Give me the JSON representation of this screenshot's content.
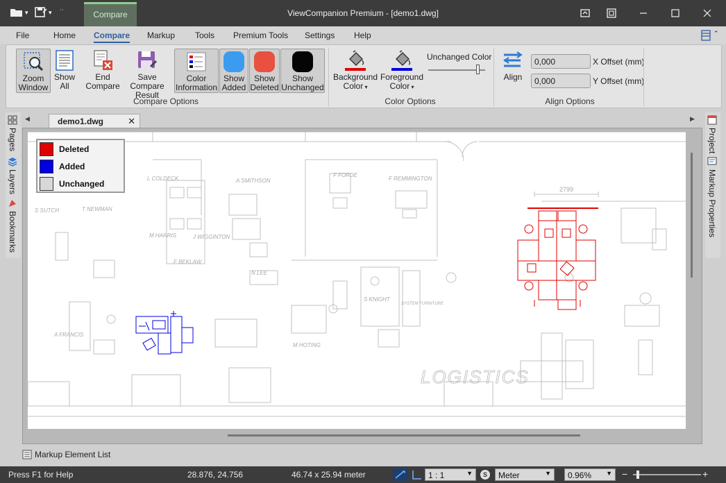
{
  "titlebar": {
    "context_tab": "Compare",
    "title": "ViewCompanion Premium - [demo1.dwg]"
  },
  "menu": [
    "File",
    "Home",
    "Compare",
    "Markup",
    "Tools",
    "Premium Tools",
    "Settings",
    "Help"
  ],
  "ribbon": {
    "zoom_window": "Zoom Window",
    "show_all": "Show All",
    "end_compare": "End Compare",
    "save_compare_result": "Save Compare Result",
    "color_information": "Color Information",
    "show_added": "Show Added",
    "show_deleted": "Show Deleted",
    "show_unchanged": "Show Unchanged",
    "compare_options": "Compare Options",
    "background_color": "Background Color",
    "foreground_color": "Foreground Color",
    "unchanged_color": "Unchanged Color",
    "color_options": "Color Options",
    "align": "Align",
    "x_offset_value": "0,000",
    "x_offset_label": "X Offset (mm)",
    "y_offset_value": "0,000",
    "y_offset_label": "Y Offset (mm)",
    "align_options": "Align Options",
    "unchanged_slider_level": 0.9
  },
  "side_left": [
    "Pages",
    "Layers",
    "Bookmarks"
  ],
  "side_right": [
    "Project",
    "Markup Properties"
  ],
  "document": {
    "tab": "demo1.dwg"
  },
  "legend": [
    {
      "label": "Deleted",
      "color": "#e00000"
    },
    {
      "label": "Added",
      "color": "#0000e0"
    },
    {
      "label": "Unchanged",
      "color": "#d8d8d8"
    }
  ],
  "drawing": {
    "names": [
      "L COLDECK",
      "A SMITHSON",
      "F FORDE",
      "F REMMINGTON",
      "T NEWMAN",
      "S SUTCH",
      "M HARRIS",
      "J WIGGINTON",
      "F BEKLAW",
      "N LEE",
      "S KNIGHT",
      "SYSTEM FURNITURE",
      "M HOTING",
      "A FRANCIS"
    ],
    "dimension": "2799",
    "room_label": "LOGISTICS"
  },
  "bottom": {
    "markup_list": "Markup Element List"
  },
  "status": {
    "help": "Press F1 for Help",
    "coords": "28.876, 24.756",
    "size": "46.74 x 25.94 meter",
    "scale": "1 : 1",
    "unit": "Meter",
    "zoom": "0.96%",
    "zoom_slider_level": 0.05
  },
  "colors": {
    "added": "#0000e0",
    "deleted": "#e00000",
    "unchanged": "#000000",
    "accent": "#2f5fa0"
  }
}
